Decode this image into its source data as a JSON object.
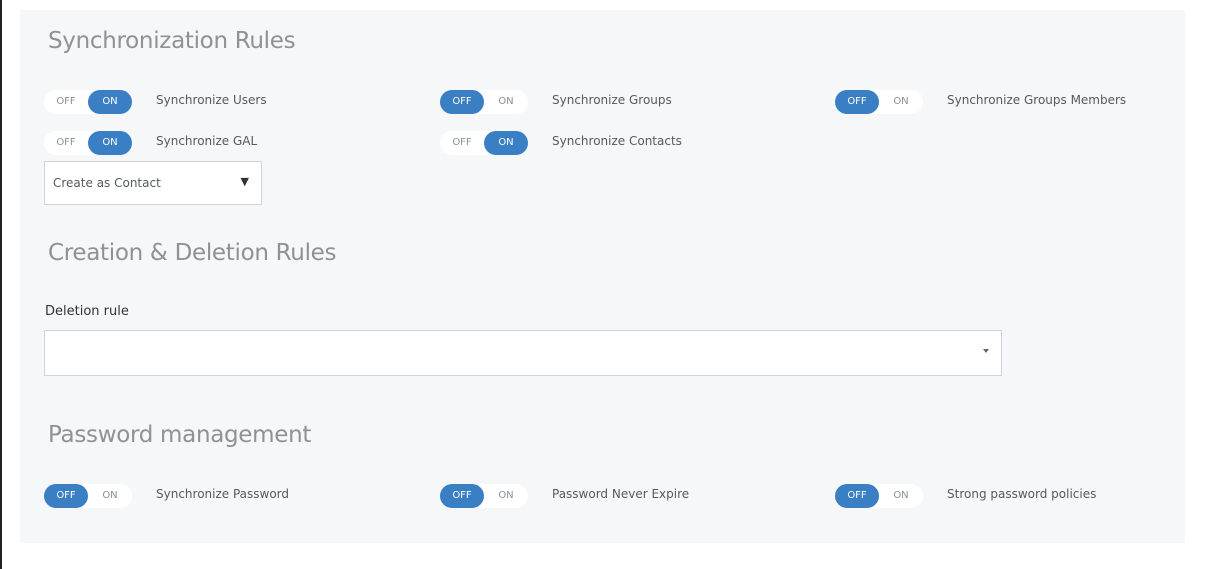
{
  "sync_rules": {
    "title": "Synchronization Rules",
    "toggles": [
      {
        "label": "Synchronize Users",
        "off": "OFF",
        "on": "ON",
        "state": "on"
      },
      {
        "label": "Synchronize Groups",
        "off": "OFF",
        "on": "ON",
        "state": "off"
      },
      {
        "label": "Synchronize Groups Members",
        "off": "OFF",
        "on": "ON",
        "state": "off"
      },
      {
        "label": "Synchronize GAL",
        "off": "OFF",
        "on": "ON",
        "state": "on"
      },
      {
        "label": "Synchronize Contacts",
        "off": "OFF",
        "on": "ON",
        "state": "on"
      }
    ],
    "gal_select": {
      "value": "Create as Contact",
      "arrow": "▼"
    }
  },
  "creation_rules": {
    "title": "Creation & Deletion Rules",
    "deletion_label": "Deletion rule",
    "deletion_value": ""
  },
  "password": {
    "title": "Password management",
    "toggles": [
      {
        "label": "Synchronize Password",
        "off": "OFF",
        "on": "ON",
        "state": "off"
      },
      {
        "label": "Password Never Expire",
        "off": "OFF",
        "on": "ON",
        "state": "off"
      },
      {
        "label": "Strong password policies",
        "off": "OFF",
        "on": "ON",
        "state": "off"
      }
    ]
  },
  "colors": {
    "accent": "#3a7fc4",
    "panel": "#f5f7f9",
    "title": "#8d9296"
  }
}
